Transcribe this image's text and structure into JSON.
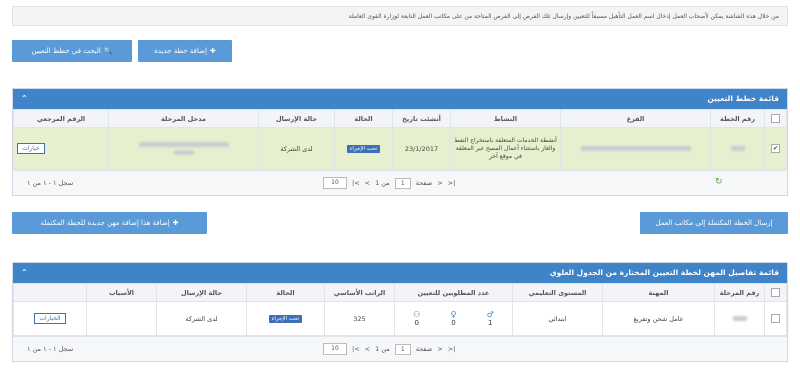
{
  "notice": "من خلال هذه الشاشة يمكن لأصحاب العمل إدخال اسم العمل التأهيل مسبقاً للتعيين وإرسال تلك الفرص إلى الفرص المتاحة من على مكاتب العمل التابعة لوزارة القوى العاملة",
  "top_buttons": {
    "add_plan": "إضافة خطة جديدة",
    "search_plans": "البحث في خطط التعيين"
  },
  "plans_panel": {
    "title": "قائمة خطط التعيين",
    "headers": [
      "رقم الخطة",
      "الفرع",
      "النشاط",
      "أنشئت تاريخ",
      "الحالة",
      "حالة الإرسال",
      "مدخل المرحلة",
      "الرقم المرجعي"
    ],
    "row": {
      "activity": "أنشطة الخدمات المتعلقة باستخراج النفط والغاز باستثناء أعمال المسح غير المعلقة في موقع آخر",
      "date": "23/1/2017",
      "status": "تحت الإجراء",
      "send_status": "لدى الشركة",
      "options": "خيارات"
    },
    "pager": {
      "count": "سجل ١ - ١ من ١",
      "page_label": "صفحة",
      "page": "1",
      "of": "من 1",
      "per_page": "10"
    }
  },
  "mid_buttons": {
    "send": "إرسال الخطة المكتملة إلى مكاتب العمل",
    "add_job": "إضافة هذا إضافة مهن جديدة للخطة المكتملة"
  },
  "jobs_panel": {
    "title": "قائمة تفاصيل المهن لخطة التعيين المختارة من الجدول العلوي",
    "headers": [
      "رقم المرحلة",
      "المهنة",
      "المستوى التعليمي",
      "عدد المطلوبين للتعيين",
      "الراتب الأساسي",
      "الحالة",
      "حالة الإرسال",
      "الأسباب"
    ],
    "row": {
      "job": "عامل شحن وتفريغ",
      "education": "ابتدائي",
      "counts": [
        "1",
        "0",
        "0"
      ],
      "salary": "325",
      "status": "تحت الإجراء",
      "send_status": "لدى الشركة",
      "options": "الخيارات"
    },
    "pager": {
      "count": "سجل ١ - ١ من ١",
      "page_label": "صفحة",
      "page": "1",
      "of": "من 1",
      "per_page": "10"
    }
  }
}
